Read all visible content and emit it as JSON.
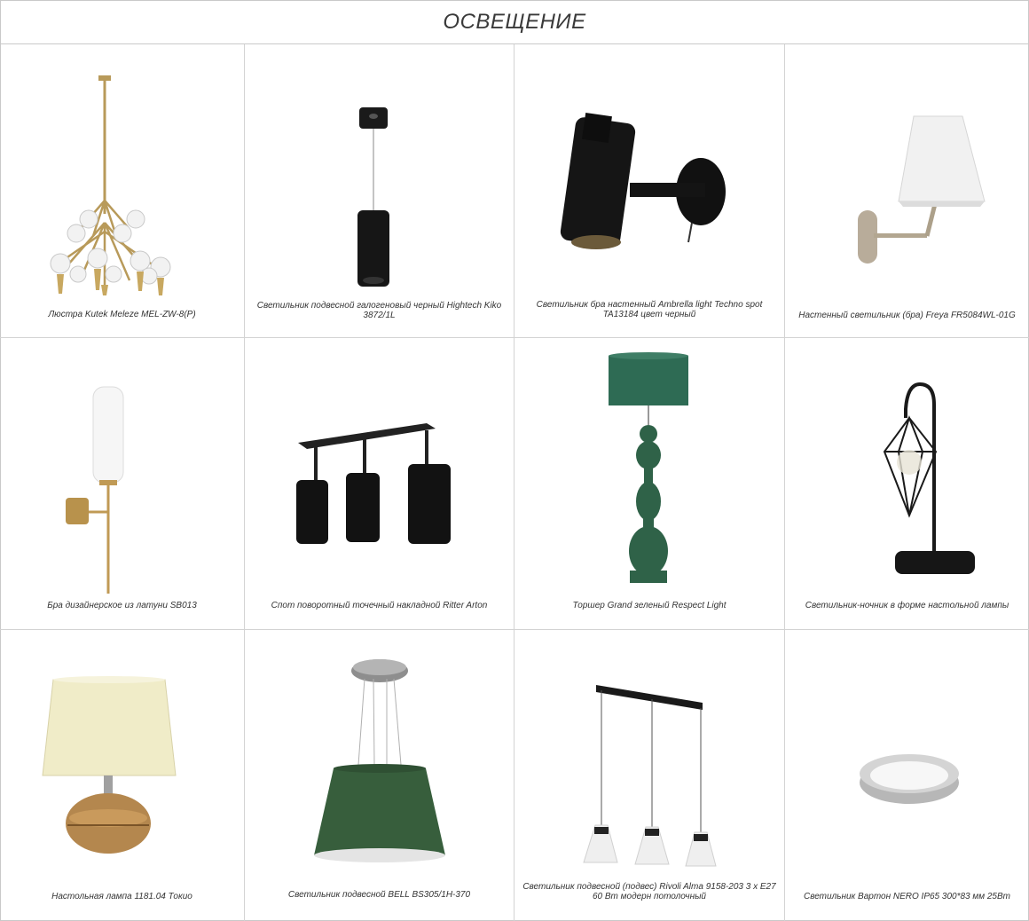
{
  "page": {
    "title": "ОСВЕЩЕНИЕ"
  },
  "products": [
    {
      "caption": "Люстра Kutek Meleze MEL-ZW-8(P)",
      "icon": "chandelier-icon"
    },
    {
      "caption": "Светильник подвесной галогеновый черный Hightech Kiko 3872/1L",
      "icon": "pendant-cylinder-icon"
    },
    {
      "caption": "Светильник бра настенный Ambrella light Techno spot TA13184 цвет черный",
      "icon": "wall-spot-icon"
    },
    {
      "caption": "Настенный светильник (бра) Freya FR5084WL-01G",
      "icon": "wall-sconce-icon"
    },
    {
      "caption": "Бра дизайнерское из латуни SB013",
      "icon": "brass-sconce-icon"
    },
    {
      "caption": "Спот поворотный точечный накладной Ritter Arton",
      "icon": "triple-spot-icon"
    },
    {
      "caption": "Торшер Grand зеленый Respect Light",
      "icon": "floor-lamp-icon"
    },
    {
      "caption": "Светильник-ночник в форме настольной лампы",
      "icon": "night-lamp-icon"
    },
    {
      "caption": "Настольная лампа 1181.04 Токио",
      "icon": "table-lamp-icon"
    },
    {
      "caption": "Светильник подвесной BELL BS305/1H-370",
      "icon": "drum-pendant-icon"
    },
    {
      "caption": "Светильник подвесной (подвес) Rivoli Alma 9158-203 3 х Е27 60 Вт модерн потолочный",
      "icon": "triple-pendant-icon"
    },
    {
      "caption": "Светильник Вартон NERO IP65 300*83 мм 25Вт",
      "icon": "ceiling-light-icon"
    }
  ]
}
